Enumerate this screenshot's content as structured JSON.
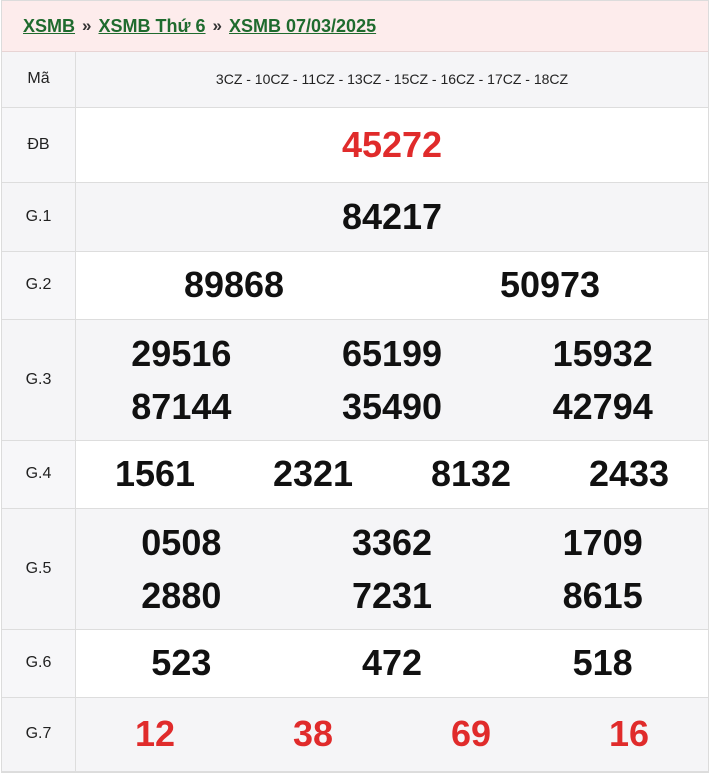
{
  "breadcrumb": {
    "items": [
      "XSMB",
      "XSMB Thứ 6",
      "XSMB 07/03/2025"
    ],
    "separator": "»"
  },
  "table": {
    "code_label": "Mã",
    "codes": "3CZ - 10CZ - 11CZ - 13CZ - 15CZ - 16CZ - 17CZ - 18CZ",
    "labels": {
      "db": "ĐB",
      "g1": "G.1",
      "g2": "G.2",
      "g3": "G.3",
      "g4": "G.4",
      "g5": "G.5",
      "g6": "G.6",
      "g7": "G.7"
    },
    "db": [
      "45272"
    ],
    "g1": [
      "84217"
    ],
    "g2": [
      "89868",
      "50973"
    ],
    "g3": [
      "29516",
      "65199",
      "15932",
      "87144",
      "35490",
      "42794"
    ],
    "g4": [
      "1561",
      "2321",
      "8132",
      "2433"
    ],
    "g5": [
      "0508",
      "3362",
      "1709",
      "2880",
      "7231",
      "8615"
    ],
    "g6": [
      "523",
      "472",
      "518"
    ],
    "g7": [
      "12",
      "38",
      "69",
      "16"
    ]
  },
  "colors": {
    "link_green": "#1f6b2e",
    "highlight_red": "#e02b2b",
    "header_bg": "#fdecec"
  }
}
